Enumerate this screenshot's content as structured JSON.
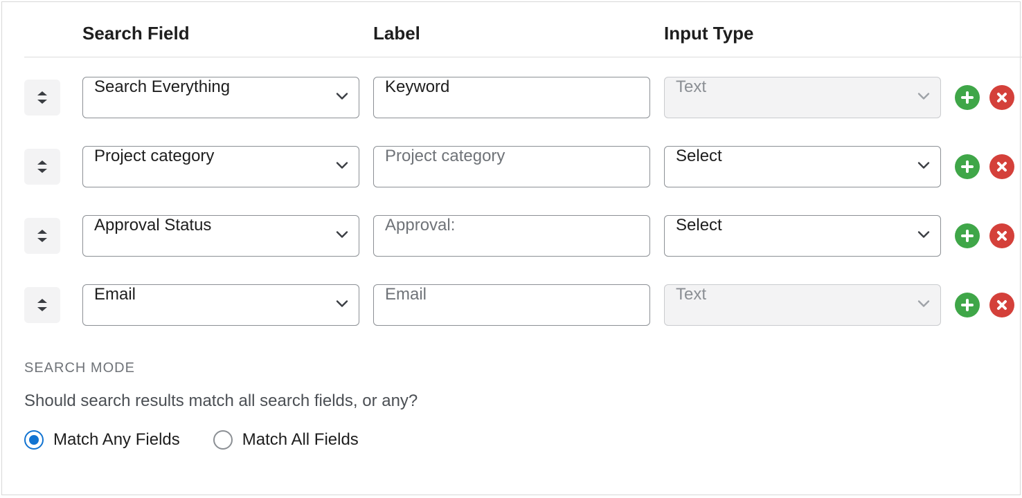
{
  "headers": {
    "search_field": "Search Field",
    "label": "Label",
    "input_type": "Input Type"
  },
  "rows": [
    {
      "search_field": "Search Everything",
      "label_value": "Keyword",
      "label_placeholder": "",
      "input_type": "Text",
      "input_type_disabled": true
    },
    {
      "search_field": "Project category",
      "label_value": "",
      "label_placeholder": "Project category",
      "input_type": "Select",
      "input_type_disabled": false
    },
    {
      "search_field": "Approval Status",
      "label_value": "",
      "label_placeholder": "Approval:",
      "input_type": "Select",
      "input_type_disabled": false
    },
    {
      "search_field": "Email",
      "label_value": "",
      "label_placeholder": "Email",
      "input_type": "Text",
      "input_type_disabled": true
    }
  ],
  "search_mode": {
    "title": "SEARCH MODE",
    "description": "Should search results match all search fields, or any?",
    "options": {
      "any": "Match Any Fields",
      "all": "Match All Fields"
    },
    "selected": "any"
  }
}
